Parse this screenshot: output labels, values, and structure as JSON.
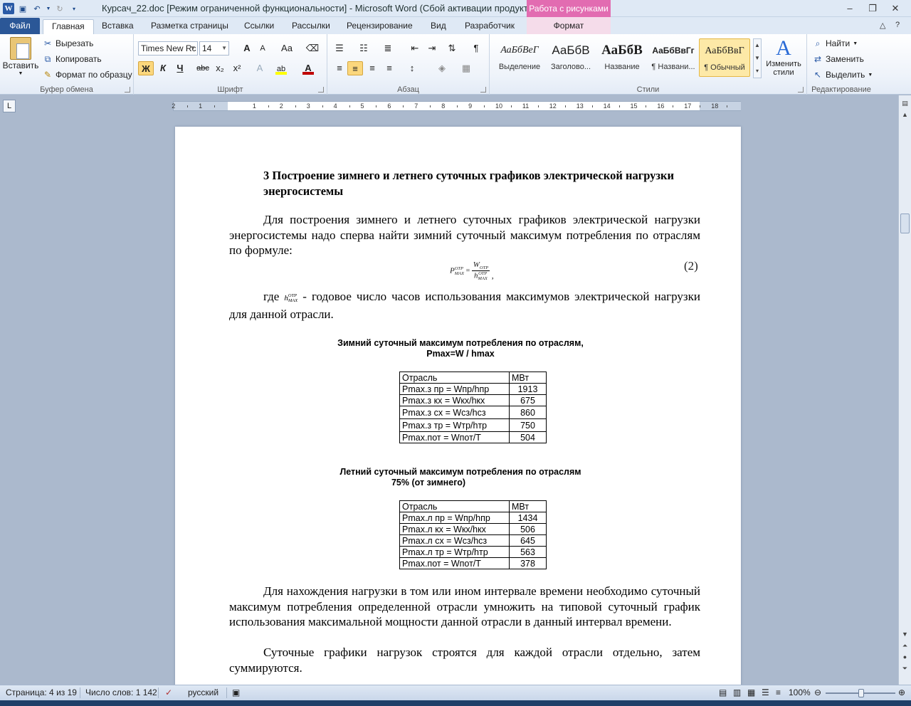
{
  "titlebar": {
    "title": "Курсач_22.doc [Режим ограниченной функциональности]  -  Microsoft Word (Сбой активации продукта)",
    "context_header": "Работа с рисунками",
    "word_icon": "W"
  },
  "tabs": {
    "file": "Файл",
    "items": [
      "Главная",
      "Вставка",
      "Разметка страницы",
      "Ссылки",
      "Рассылки",
      "Рецензирование",
      "Вид",
      "Разработчик"
    ],
    "context_tab": "Формат"
  },
  "ribbon": {
    "clipboard": {
      "label": "Буфер обмена",
      "paste": "Вставить",
      "cut": "Вырезать",
      "copy": "Копировать",
      "format_painter": "Формат по образцу"
    },
    "font": {
      "label": "Шрифт",
      "font_name": "Times New Rc",
      "font_size": "14",
      "grow": "A",
      "shrink": "A",
      "case": "Aa",
      "bold": "Ж",
      "italic": "К",
      "underline": "Ч",
      "strike": "abc",
      "subscript": "x₂",
      "superscript": "x²",
      "highlight_color": "#ffff00",
      "font_color": "#c00000"
    },
    "paragraph": {
      "label": "Абзац"
    },
    "styles": {
      "label": "Стили",
      "items": [
        {
          "sample": "АаБбВеГ",
          "name": "Выделение"
        },
        {
          "sample": "АаБбВ",
          "name": "Заголово..."
        },
        {
          "sample": "АаБбВ",
          "name": "Название"
        },
        {
          "sample": "АаБбВвГг",
          "name": "¶ Названи..."
        },
        {
          "sample": "АаБбВвГ",
          "name": "¶ Обычный"
        }
      ],
      "change_styles": "Изменить стили"
    },
    "editing": {
      "label": "Редактирование",
      "find": "Найти",
      "replace": "Заменить",
      "select": "Выделить"
    }
  },
  "ruler": {
    "corner": "L",
    "numbers": [
      "2",
      "1",
      "1",
      "2",
      "3",
      "4",
      "5",
      "6",
      "7",
      "8",
      "9",
      "10",
      "11",
      "12",
      "13",
      "14",
      "15",
      "16",
      "17",
      "18"
    ]
  },
  "document": {
    "heading": "3 Построение зимнего и летнего суточных графиков электрической нагрузки энергосистемы",
    "p1": "Для построения зимнего и летнего суточных графиков электрической нагрузки энергосистемы надо сперва найти зимний суточный максимум потребления по отраслям по формуле:",
    "formula_lhs": "P",
    "formula_lhs_sup": "ОТР",
    "formula_lhs_sub": "MAX",
    "formula_num": "W",
    "formula_num_sub": "ОТР",
    "formula_den": "h",
    "formula_den_sup": "ОТР",
    "formula_den_sub": "MAX",
    "formula_equals": "=",
    "formula_comma": ",",
    "eq_number": "(2)",
    "p2_start": "где",
    "p2_h": "h",
    "p2_h_sup": "ОТР",
    "p2_h_sub": "MAX",
    "p2_rest": "- годовое число часов использования максимумов электрической нагрузки для данной отрасли.",
    "winter_caption_1": "Зимний суточный максимум потребления по отраслям,",
    "winter_caption_2": "Pmax=W / hmax",
    "winter_table": {
      "header": [
        "Отрасль",
        "МВт"
      ],
      "rows": [
        [
          "Pmax.з пр = Wпр/hпр",
          "1913"
        ],
        [
          "Pmax.з кх = Wкх/hкх",
          "675"
        ],
        [
          "Pmax.з сх = Wсз/hсз",
          "860"
        ],
        [
          "Pmax.з тр = Wтр/hтр",
          "750"
        ],
        [
          "Pmax.пот = Wпот/T",
          "504"
        ]
      ]
    },
    "summer_caption_1": "Летний суточный максимум потребления по отраслям",
    "summer_caption_2": "75% (от зимнего)",
    "summer_table": {
      "header": [
        "Отрасль",
        "МВт"
      ],
      "rows": [
        [
          "Pmax.л пр = Wпр/hпр",
          "1434"
        ],
        [
          "Pmax.л кх = Wкх/hкх",
          "506"
        ],
        [
          "Pmax.л сх = Wсз/hсз",
          "645"
        ],
        [
          "Pmax.л тр = Wтр/hтр",
          "563"
        ],
        [
          "Pmax.пот = Wпот/T",
          "378"
        ]
      ]
    },
    "p3": "Для нахождения нагрузки в том или ином интервале времени необходимо суточный максимум потребления определенной отрасли умножить на типовой суточный график использования максимальной мощности данной отрасли в данный интервал времени.",
    "p4": "Суточные графики нагрузок строятся для каждой отрасли отдельно, затем суммируются."
  },
  "statusbar": {
    "page": "Страница: 4 из 19",
    "words": "Число слов: 1 142",
    "language": "русский",
    "zoom": "100%"
  }
}
